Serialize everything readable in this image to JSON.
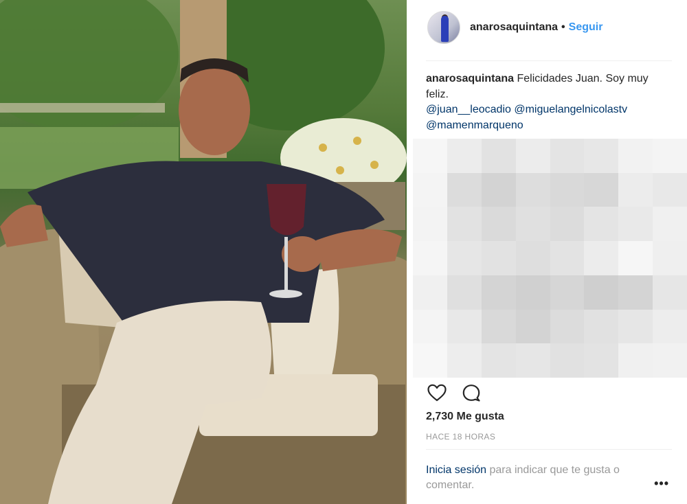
{
  "post": {
    "author": "anarosaquintana",
    "separator": "•",
    "follow_label": "Seguir",
    "caption_user": "anarosaquintana",
    "caption_text": " Felicidades Juan. Soy muy feliz.",
    "mentions": [
      "@juan__leocadio",
      "@miguelangelnicolastv",
      "@mamenmarqueno"
    ],
    "likes": "2,730 Me gusta",
    "time_ago": "HACE 18 HORAS",
    "login_link": "Inicia sesión",
    "login_text": " para indicar que te gusta o comentar.",
    "more_label": "•••"
  },
  "icons": {
    "like": "heart-icon",
    "comment": "comment-bubble-icon",
    "more": "more-options-icon"
  },
  "colors": {
    "link_blue": "#3897f0",
    "mention_blue": "#003569",
    "muted_text": "#999999"
  },
  "pixel_tiles": [
    "#f6f6f6",
    "#ececec",
    "#e2e2e2",
    "#ececec",
    "#e4e4e4",
    "#e7e7e7",
    "#f2f2f2",
    "#f4f4f4",
    "#f4f4f4",
    "#dcdcdc",
    "#d3d3d3",
    "#dddddd",
    "#d9d9d9",
    "#d7d7d7",
    "#ececec",
    "#e8e8e8",
    "#f3f3f3",
    "#e2e2e2",
    "#dadada",
    "#e0e0e0",
    "#dcdcdc",
    "#e4e4e4",
    "#e9e9e9",
    "#f0f0f0",
    "#f5f5f5",
    "#e6e6e6",
    "#e2e2e2",
    "#dedede",
    "#e3e3e3",
    "#ececec",
    "#f6f6f6",
    "#efefef",
    "#f0f0f0",
    "#dfdfdf",
    "#d4d4d4",
    "#d0d0d0",
    "#d6d6d6",
    "#cfcfcf",
    "#d4d4d4",
    "#e6e6e6",
    "#f4f4f4",
    "#e8e8e8",
    "#d9d9d9",
    "#d3d3d3",
    "#dcdcdc",
    "#e1e1e1",
    "#e6e6e6",
    "#ededed",
    "#f7f7f7",
    "#ededed",
    "#e4e4e4",
    "#e6e6e6",
    "#e1e1e1",
    "#e3e3e3",
    "#f0f0f0",
    "#f1f1f1"
  ]
}
